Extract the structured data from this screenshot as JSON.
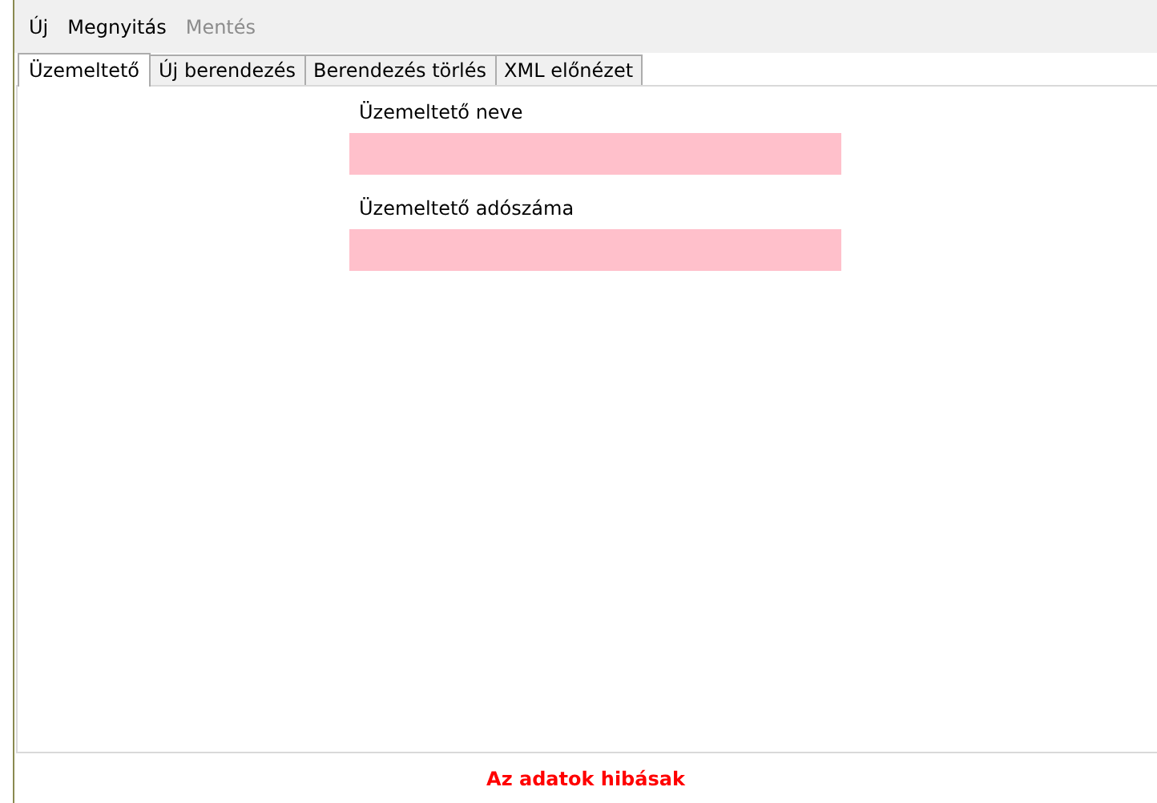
{
  "menu": [
    {
      "label": "Új",
      "disabled": false
    },
    {
      "label": "Megnyitás",
      "disabled": false
    },
    {
      "label": "Mentés",
      "disabled": true
    }
  ],
  "tabs": [
    {
      "label": "Üzemeltető",
      "selected": true
    },
    {
      "label": "Új berendezés",
      "selected": false
    },
    {
      "label": "Berendezés törlés",
      "selected": false
    },
    {
      "label": "XML előnézet",
      "selected": false
    }
  ],
  "fields": [
    {
      "label": "Üzemeltető neve",
      "invalid": true
    },
    {
      "label": "Üzemeltető adószáma",
      "invalid": true
    }
  ],
  "status": {
    "text": "Az adatok hibásak",
    "error": true
  }
}
